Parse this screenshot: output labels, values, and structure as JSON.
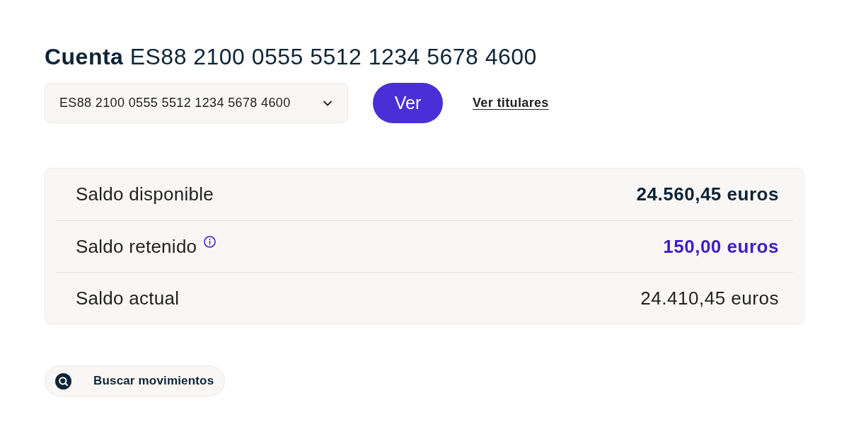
{
  "heading": "**Cuenta** ES88 2100 0555 5512 1234 5678 4600",
  "account_select": {
    "value": "ES88 2100 0555 5512 1234 5678 4600"
  },
  "view_button": "Ver",
  "holders_link": "Ver titulares",
  "balances": [
    {
      "label": "Saldo disponible",
      "amount": "24.560,45 euros",
      "kind": "emphasis",
      "info": false
    },
    {
      "label": "Saldo retenido",
      "amount": "150,00 euros",
      "kind": "held",
      "info": true
    },
    {
      "label": "Saldo actual",
      "amount": "24.410,45 euros",
      "kind": "plain",
      "info": false
    }
  ],
  "search_button": "Buscar movimientos"
}
